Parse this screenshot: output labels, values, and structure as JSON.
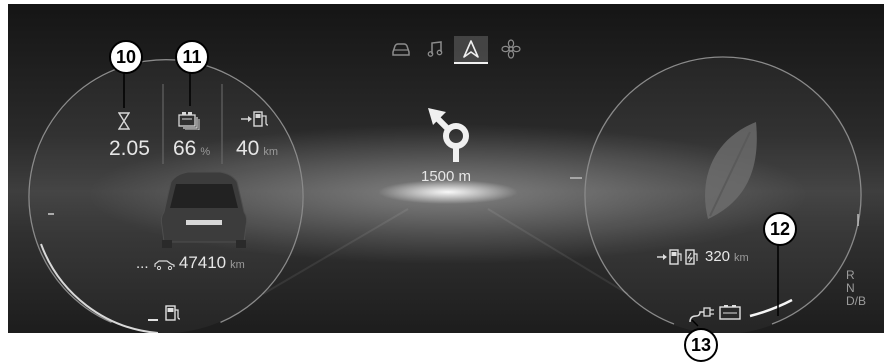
{
  "nav_tabs": [
    {
      "icon": "car-icon",
      "active": false
    },
    {
      "icon": "music-note-icon",
      "active": false
    },
    {
      "icon": "navigation-arrow-icon",
      "active": true
    },
    {
      "icon": "fan-icon",
      "active": false
    }
  ],
  "left_dial": {
    "trip_time": "2.05",
    "battery_level": "66",
    "battery_unit": "%",
    "range_to_charge": "40",
    "range_unit": "km",
    "odometer_prefix": "...",
    "odometer": "47410",
    "odometer_unit": "km"
  },
  "navigation": {
    "maneuver_icon": "roundabout-turn-left-icon",
    "distance": "1500 m"
  },
  "right_dial": {
    "eco_icon": "leaf-icon",
    "range": "320",
    "range_unit": "km"
  },
  "gear_selector": {
    "gears": [
      "R",
      "N",
      "D/B"
    ]
  },
  "callouts": [
    "10",
    "11",
    "12",
    "13"
  ],
  "colors": {
    "background": "#2a2a2a",
    "text": "#e6e6e6",
    "unit_text": "#9a9a9a",
    "dial_ring": "#8a8a8a",
    "callout_fill": "#ffffff",
    "callout_border": "#000000"
  }
}
